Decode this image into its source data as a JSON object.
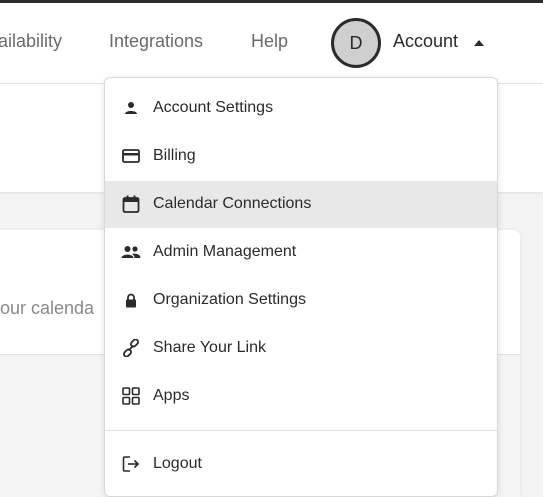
{
  "nav": {
    "links": [
      "ailability",
      "Integrations",
      "Help"
    ],
    "avatar_initial": "D",
    "account_label": "Account"
  },
  "card": {
    "partial_text": "our calenda"
  },
  "dropdown": {
    "items": [
      {
        "label": "Account Settings",
        "icon": "person-icon"
      },
      {
        "label": "Billing",
        "icon": "credit-card-icon"
      },
      {
        "label": "Calendar Connections",
        "icon": "calendar-icon",
        "highlighted": true
      },
      {
        "label": "Admin Management",
        "icon": "people-icon"
      },
      {
        "label": "Organization Settings",
        "icon": "lock-icon"
      },
      {
        "label": "Share Your Link",
        "icon": "link-icon"
      },
      {
        "label": "Apps",
        "icon": "apps-grid-icon"
      }
    ],
    "logout": {
      "label": "Logout",
      "icon": "logout-icon"
    }
  },
  "colors": {
    "highlight": "#e8e8e8",
    "text_dark": "#2b2b2b",
    "nav_text": "#6b6b6b"
  }
}
